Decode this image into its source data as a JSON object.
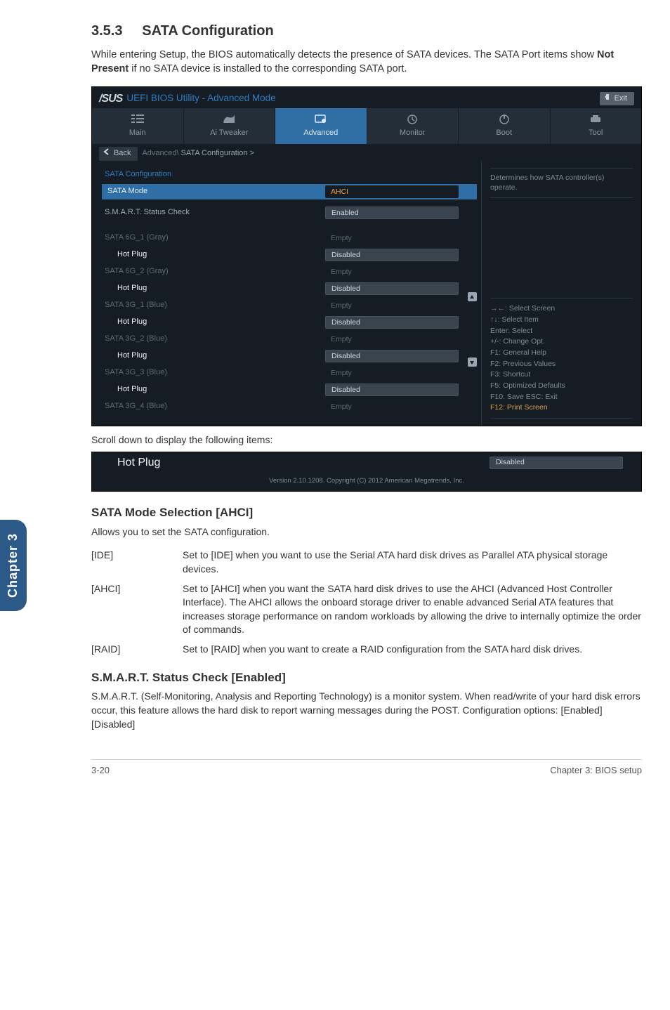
{
  "page": {
    "section_number": "3.5.3",
    "section_title": "SATA Configuration",
    "intro": "While entering Setup, the BIOS automatically detects the presence of SATA devices. The SATA Port items show Not Present if no SATA device is installed to the corresponding SATA port.",
    "scroll_caption": "Scroll down to display the following items:",
    "side_tab": "Chapter 3",
    "footer_left": "3-20",
    "footer_right": "Chapter 3: BIOS setup"
  },
  "bios": {
    "brand": "/SUS",
    "title": "UEFI BIOS Utility - Advanced Mode",
    "exit": "Exit",
    "tabs": [
      "Main",
      "Ai Tweaker",
      "Advanced",
      "Monitor",
      "Boot",
      "Tool"
    ],
    "active_tab_index": 2,
    "back": "Back",
    "breadcrumb_prefix": "Advanced\\ ",
    "breadcrumb_strong": "SATA Configuration >",
    "heading": "SATA Configuration",
    "selected": {
      "label": "SATA Mode",
      "value": "AHCI"
    },
    "rows": [
      {
        "label": "S.M.A.R.T. Status Check",
        "type": "field",
        "value": "Enabled",
        "cls": "row-label"
      },
      {
        "label": "SATA 6G_1 (Gray)",
        "type": "text",
        "value": "Empty",
        "cls": "row-label gray-indent"
      },
      {
        "label": "Hot Plug",
        "type": "field",
        "value": "Disabled",
        "cls": "row-label sub"
      },
      {
        "label": "SATA 6G_2 (Gray)",
        "type": "text",
        "value": "Empty",
        "cls": "row-label gray-indent"
      },
      {
        "label": "Hot Plug",
        "type": "field",
        "value": "Disabled",
        "cls": "row-label sub"
      },
      {
        "label": "SATA 3G_1 (Blue)",
        "type": "text",
        "value": "Empty",
        "cls": "row-label gray-indent"
      },
      {
        "label": "Hot Plug",
        "type": "field",
        "value": "Disabled",
        "cls": "row-label sub"
      },
      {
        "label": "SATA 3G_2 (Blue)",
        "type": "text",
        "value": "Empty",
        "cls": "row-label gray-indent"
      },
      {
        "label": "Hot Plug",
        "type": "field",
        "value": "Disabled",
        "cls": "row-label sub"
      },
      {
        "label": "SATA 3G_3 (Blue)",
        "type": "text",
        "value": "Empty",
        "cls": "row-label gray-indent"
      },
      {
        "label": "Hot Plug",
        "type": "field",
        "value": "Disabled",
        "cls": "row-label sub"
      },
      {
        "label": "SATA 3G_4 (Blue)",
        "type": "text",
        "value": "Empty",
        "cls": "row-label gray-indent"
      }
    ],
    "help_top": "Determines how SATA controller(s) operate.",
    "help_keys": [
      "→←: Select Screen",
      "↑↓: Select Item",
      "Enter: Select",
      "+/-: Change Opt.",
      "F1: General Help",
      "F2: Previous Values",
      "F3: Shortcut",
      "F5: Optimized Defaults",
      "F10: Save   ESC: Exit",
      "F12: Print Screen"
    ],
    "highlight_key_index": 9
  },
  "bios2": {
    "row": {
      "label": "Hot Plug",
      "value": "Disabled"
    },
    "version": "Version 2.10.1208.  Copyright (C) 2012 American Megatrends, Inc."
  },
  "doc": {
    "h3a": "SATA Mode Selection [AHCI]",
    "p1": "Allows you to set the SATA configuration.",
    "defs": [
      {
        "k": "[IDE]",
        "v": "Set to [IDE] when you want to use the Serial ATA hard disk drives as Parallel ATA physical storage devices."
      },
      {
        "k": "[AHCI]",
        "v": "Set to [AHCI] when you want the SATA hard disk drives to use the AHCI (Advanced Host Controller Interface). The AHCI allows the onboard storage driver to enable advanced Serial ATA features that increases storage performance on random workloads by allowing the drive to internally optimize the order of commands."
      },
      {
        "k": "[RAID]",
        "v": "Set to [RAID] when you want to create a RAID configuration from the SATA hard disk drives."
      }
    ],
    "h3b": "S.M.A.R.T. Status Check [Enabled]",
    "p2": "S.M.A.R.T. (Self-Monitoring, Analysis and Reporting Technology) is a monitor system. When read/write of your hard disk errors occur, this feature allows the hard disk to report warning messages during the POST. Configuration options: [Enabled] [Disabled]"
  }
}
